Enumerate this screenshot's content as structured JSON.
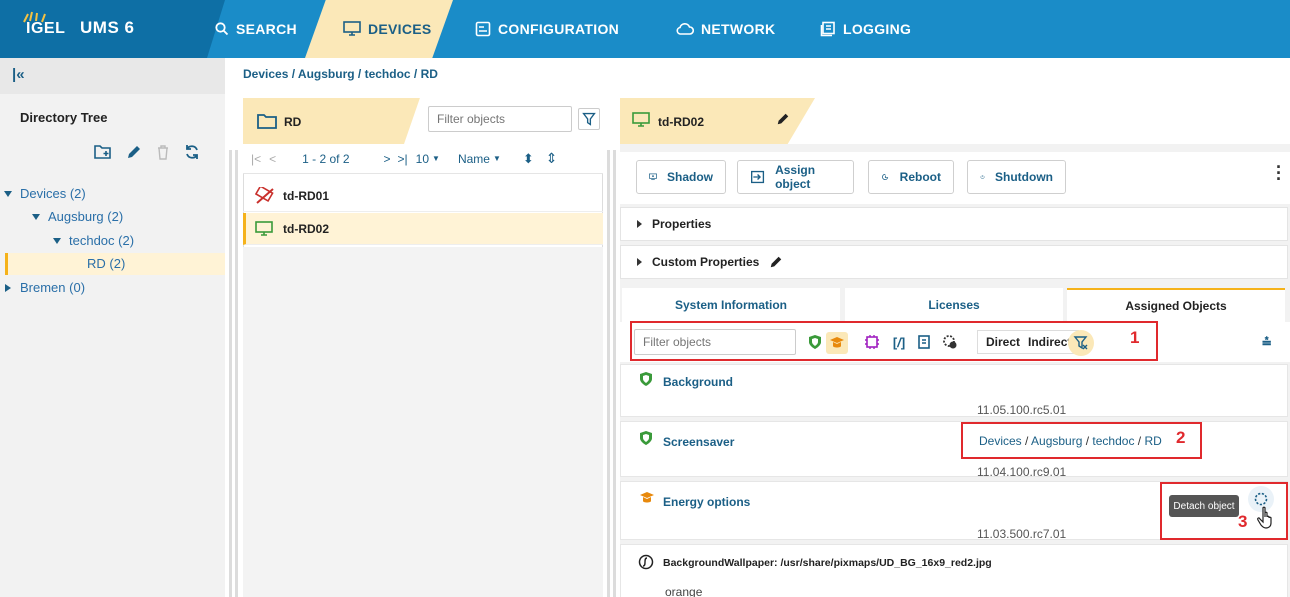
{
  "app": {
    "title": "UMS 6",
    "brand": "IGEL",
    "accent": "#1a8cc8",
    "highlight": "#fbe8b8"
  },
  "nav": {
    "tabs": [
      {
        "label": "SEARCH",
        "icon": "search-icon"
      },
      {
        "label": "DEVICES",
        "icon": "monitor-icon",
        "active": true
      },
      {
        "label": "CONFIGURATION",
        "icon": "configuration-icon"
      },
      {
        "label": "NETWORK",
        "icon": "cloud-icon"
      },
      {
        "label": "LOGGING",
        "icon": "logging-icon"
      }
    ]
  },
  "sidebar": {
    "collapse_icon": "collapse-left-icon",
    "title": "Directory Tree",
    "tree": [
      {
        "label": "Devices (2)",
        "level": 0,
        "expanded": true
      },
      {
        "label": "Augsburg (2)",
        "level": 1,
        "expanded": true
      },
      {
        "label": "techdoc (2)",
        "level": 2,
        "expanded": true
      },
      {
        "label": "RD (2)",
        "level": 3,
        "selected": true
      },
      {
        "label": "Bremen (0)",
        "level": 0,
        "expanded": false
      }
    ]
  },
  "breadcrumb": "Devices / Augsburg / techdoc / RD",
  "middle": {
    "folder_name": "RD",
    "filter_placeholder": "Filter objects",
    "pager": {
      "range": "1 - 2 of 2",
      "page_size": "10",
      "sort": "Name"
    },
    "devices": [
      {
        "name": "td-RD01",
        "status": "offline"
      },
      {
        "name": "td-RD02",
        "status": "online",
        "selected": true
      }
    ]
  },
  "detail": {
    "device_name": "td-RD02",
    "actions": [
      "Shadow",
      "Assign object",
      "Reboot",
      "Shutdown"
    ],
    "sections": [
      "Properties",
      "Custom Properties"
    ],
    "subtabs": [
      "System Information",
      "Licenses",
      "Assigned Objects"
    ],
    "active_subtab": "Assigned Objects",
    "filter_placeholder": "Filter objects",
    "filter_direct": "Direct",
    "filter_indirect": "Indirect",
    "objects": [
      {
        "name": "Background",
        "version": "11.05.100.rc5.01",
        "icon": "shield-green-icon"
      },
      {
        "name": "Screensaver",
        "version": "11.04.100.rc9.01",
        "path": [
          "Devices",
          "Augsburg",
          "techdoc",
          "RD"
        ],
        "icon": "shield-green-icon"
      },
      {
        "name": "Energy options",
        "version": "11.03.500.rc7.01",
        "icon": "mortarboard-orange-icon"
      },
      {
        "name": "BackgroundWallpaper: /usr/share/pixmaps/UD_BG_16x9_red2.jpg",
        "value": "orange",
        "icon": "parameter-icon"
      }
    ],
    "tooltip": "Detach object",
    "callouts": [
      "1",
      "2",
      "3"
    ]
  }
}
